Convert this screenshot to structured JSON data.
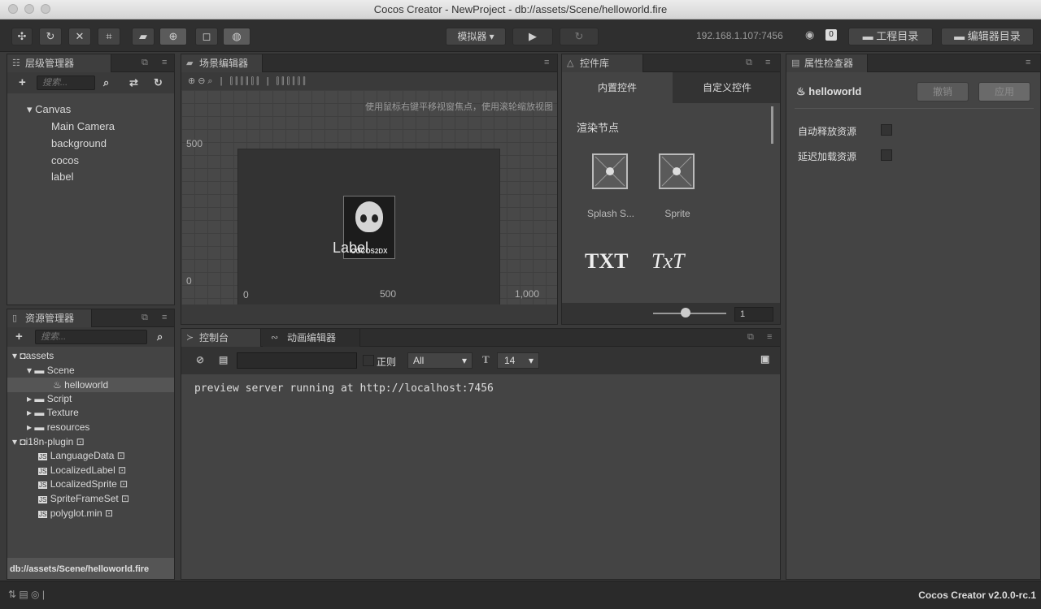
{
  "window": {
    "title": "Cocos Creator - NewProject - db://assets/Scene/helloworld.fire"
  },
  "toolbar": {
    "simulator_label": "模拟器 ▾",
    "play_icon": "play-icon",
    "refresh_icon": "refresh-icon",
    "ip_address": "192.168.1.107:7456",
    "wifi_badge": "0",
    "project_dir_label": "工程目录",
    "editor_dir_label": "编辑器目录"
  },
  "hierarchy": {
    "title": "层级管理器",
    "search_placeholder": "搜索...",
    "items": [
      {
        "label": "Canvas",
        "expanded": true
      },
      {
        "label": "Main Camera"
      },
      {
        "label": "background"
      },
      {
        "label": "cocos"
      },
      {
        "label": "label"
      }
    ]
  },
  "scene_editor": {
    "title": "场景编辑器",
    "hint": "使用鼠标右键平移视窗焦点，使用滚轮缩放视图",
    "y_ticks": [
      "500",
      "0"
    ],
    "x_ticks": [
      "0",
      "500",
      "1,000"
    ],
    "canvas_label": "Label",
    "logo_text": "COCOS2DX"
  },
  "control_library": {
    "title": "控件库",
    "tabs": [
      "内置控件",
      "自定义控件"
    ],
    "section_title": "渲染节点",
    "items": [
      {
        "label": "Splash S..."
      },
      {
        "label": "Sprite"
      }
    ],
    "text_items": [
      "TXT",
      "TxT"
    ],
    "zoom_value": "1"
  },
  "inspector": {
    "title": "属性检查器",
    "node_name": "helloworld",
    "undo_label": "撤销",
    "apply_label": "应用",
    "options": [
      {
        "label": "自动释放资源",
        "checked": false
      },
      {
        "label": "延迟加载资源",
        "checked": false
      }
    ]
  },
  "assets": {
    "title": "资源管理器",
    "search_placeholder": "搜索...",
    "items": [
      {
        "label": "assets",
        "depth": 0,
        "type": "db",
        "expanded": true
      },
      {
        "label": "Scene",
        "depth": 1,
        "type": "folder",
        "expanded": true
      },
      {
        "label": "helloworld",
        "depth": 2,
        "type": "scene",
        "selected": true
      },
      {
        "label": "Script",
        "depth": 1,
        "type": "folder"
      },
      {
        "label": "Texture",
        "depth": 1,
        "type": "folder"
      },
      {
        "label": "resources",
        "depth": 1,
        "type": "folder"
      },
      {
        "label": "i18n-plugin",
        "depth": 0,
        "type": "db",
        "locked": true,
        "expanded": true
      },
      {
        "label": "LanguageData",
        "depth": 1,
        "type": "js",
        "locked": true
      },
      {
        "label": "LocalizedLabel",
        "depth": 1,
        "type": "js",
        "locked": true
      },
      {
        "label": "LocalizedSprite",
        "depth": 1,
        "type": "js",
        "locked": true
      },
      {
        "label": "SpriteFrameSet",
        "depth": 1,
        "type": "js",
        "locked": true
      },
      {
        "label": "polyglot.min",
        "depth": 1,
        "type": "js",
        "locked": true
      }
    ],
    "path": "db://assets/Scene/helloworld.fire"
  },
  "console": {
    "tabs": [
      "控制台",
      "动画编辑器"
    ],
    "regex_label": "正则",
    "level_select": "All",
    "font_size": "14",
    "log": "preview server running at http://localhost:7456"
  },
  "statusbar": {
    "version": "Cocos Creator v2.0.0-rc.1"
  }
}
